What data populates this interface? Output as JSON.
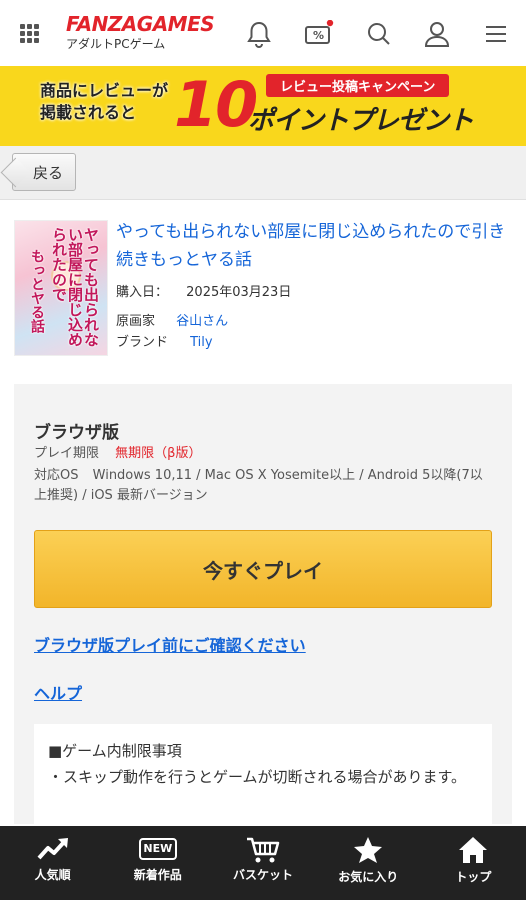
{
  "header": {
    "logo_main": "FANZAGAMES",
    "logo_sub": "アダルトPCゲーム",
    "coupon_badge": "%"
  },
  "banner": {
    "left_line1": "商品にレビューが",
    "left_line2": "掲載されると",
    "number": "10",
    "tag": "レビュー投稿キャンペーン",
    "right": "ポイントプレゼント"
  },
  "back": {
    "label": "戻る"
  },
  "product": {
    "title": "やっても出られない部屋に閉じ込められたので引き続きもっとヤる話",
    "cover_text_main": "ヤっても出られない部屋に閉じ込められたので",
    "cover_text_sub": "もっとヤる話",
    "purchase_label": "購入日：",
    "purchase_date": "2025年03月23日",
    "artist_label": "原画家",
    "artist": "谷山さん",
    "brand_label": "ブランド",
    "brand": "Tily"
  },
  "panel": {
    "title": "ブラウザ版",
    "period_label": "プレイ期限",
    "period_value": "無期限（β版）",
    "os_label": "対応OS",
    "os_value": "Windows 10,11 / Mac OS X Yosemite以上 / Android 5以降(7以上推奨) / iOS 最新バージョン",
    "play_button": "今すぐプレイ",
    "confirm_link": "ブラウザ版プレイ前にご確認ください",
    "help_link": "ヘルプ",
    "notice_title": "■ゲーム内制限事項",
    "notice_body": "・スキップ動作を行うとゲームが切断される場合があります。"
  },
  "nav": [
    {
      "label": "人気順",
      "icon": "trending-icon"
    },
    {
      "label": "新着作品",
      "icon": "new-icon",
      "badge": "NEW"
    },
    {
      "label": "バスケット",
      "icon": "cart-icon"
    },
    {
      "label": "お気に入り",
      "icon": "star-icon"
    },
    {
      "label": "トップ",
      "icon": "home-icon"
    }
  ],
  "colors": {
    "brand_red": "#e2242b",
    "link_blue": "#1565d8",
    "banner_yellow": "#f9d71c",
    "play_button": "#f2b52a",
    "nav_bg": "#222222"
  }
}
